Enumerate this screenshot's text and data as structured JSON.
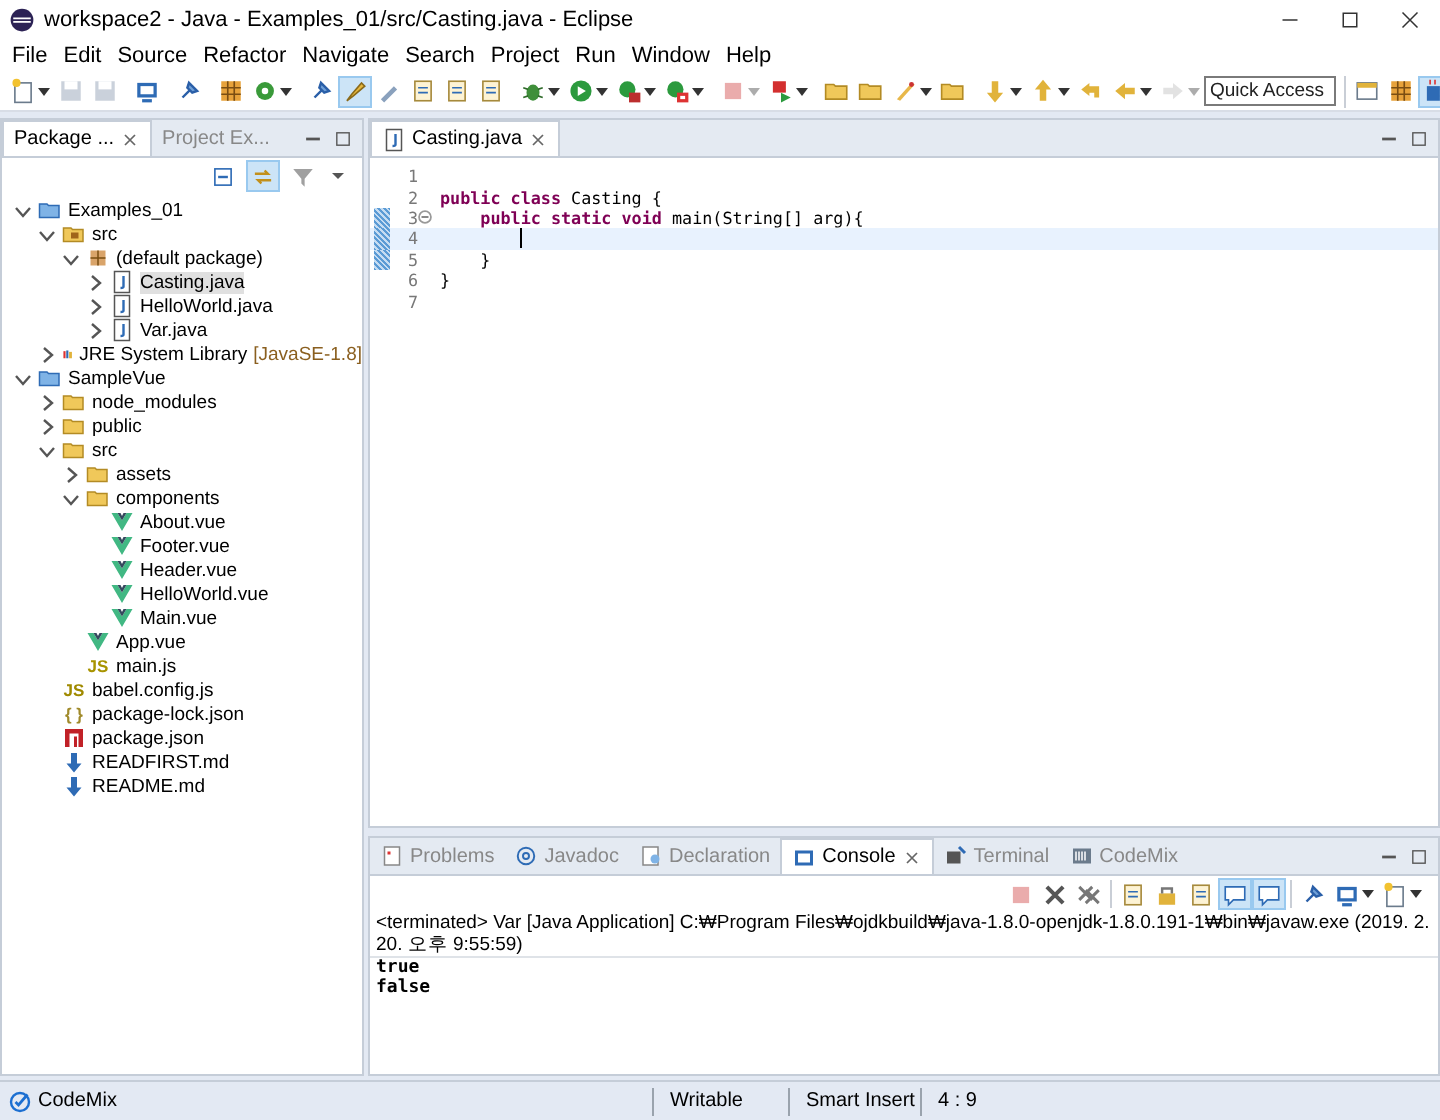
{
  "window": {
    "title": "workspace2 - Java - Examples_01/src/Casting.java - Eclipse"
  },
  "menu": [
    "File",
    "Edit",
    "Source",
    "Refactor",
    "Navigate",
    "Search",
    "Project",
    "Run",
    "Window",
    "Help"
  ],
  "toolbar": [
    {
      "items": [
        {
          "kind": "new",
          "dropdown": true,
          "disabled": false,
          "selected": false
        },
        {
          "kind": "save",
          "dropdown": false,
          "disabled": true,
          "selected": false
        },
        {
          "kind": "save",
          "dropdown": false,
          "disabled": true,
          "selected": false
        }
      ]
    },
    {
      "items": [
        {
          "kind": "monitor",
          "dropdown": false,
          "disabled": false,
          "selected": false
        }
      ]
    },
    {
      "items": [
        {
          "kind": "pin",
          "dropdown": false,
          "disabled": false,
          "selected": false
        }
      ]
    },
    {
      "items": [
        {
          "kind": "grid",
          "dropdown": false,
          "disabled": false,
          "selected": false
        },
        {
          "kind": "gear",
          "dropdown": true,
          "disabled": false,
          "selected": false
        }
      ]
    },
    {
      "items": [
        {
          "kind": "pin",
          "dropdown": false,
          "disabled": false,
          "selected": false
        },
        {
          "kind": "brush",
          "dropdown": false,
          "disabled": false,
          "selected": true
        },
        {
          "kind": "pen",
          "dropdown": false,
          "disabled": false,
          "selected": false
        },
        {
          "kind": "page",
          "dropdown": false,
          "disabled": false,
          "selected": false
        },
        {
          "kind": "page",
          "dropdown": false,
          "disabled": false,
          "selected": false
        },
        {
          "kind": "page",
          "dropdown": false,
          "disabled": false,
          "selected": false
        }
      ]
    },
    {
      "items": [
        {
          "kind": "bug",
          "dropdown": true,
          "disabled": false,
          "selected": false
        },
        {
          "kind": "play",
          "dropdown": true,
          "disabled": false,
          "selected": false
        },
        {
          "kind": "run",
          "dropdown": true,
          "disabled": false,
          "selected": false
        },
        {
          "kind": "coverage",
          "dropdown": true,
          "disabled": false,
          "selected": false
        }
      ]
    },
    {
      "items": [
        {
          "kind": "stop",
          "dropdown": true,
          "disabled": true,
          "selected": false
        },
        {
          "kind": "flag",
          "dropdown": true,
          "disabled": false,
          "selected": false
        }
      ]
    },
    {
      "items": [
        {
          "kind": "folder",
          "dropdown": false,
          "disabled": false,
          "selected": false
        },
        {
          "kind": "folder",
          "dropdown": false,
          "disabled": false,
          "selected": false
        },
        {
          "kind": "rocket",
          "dropdown": true,
          "disabled": false,
          "selected": false
        },
        {
          "kind": "folder",
          "dropdown": false,
          "disabled": false,
          "selected": false
        }
      ]
    },
    {
      "items": [
        {
          "kind": "down",
          "dropdown": true,
          "disabled": false,
          "selected": false
        },
        {
          "kind": "up",
          "dropdown": true,
          "disabled": false,
          "selected": false
        },
        {
          "kind": "back",
          "dropdown": false,
          "disabled": false,
          "selected": false
        },
        {
          "kind": "left",
          "dropdown": true,
          "disabled": false,
          "selected": false
        },
        {
          "kind": "right",
          "dropdown": true,
          "disabled": true,
          "selected": false
        }
      ]
    }
  ],
  "quick_access": {
    "placeholder": "Quick Access"
  },
  "perspectives": [
    {
      "kind": "window",
      "selected": false
    },
    {
      "kind": "grid",
      "selected": false
    },
    {
      "kind": "coffee",
      "selected": true
    }
  ],
  "explorer": {
    "tabs": [
      {
        "label": "Package ...",
        "selected": true
      },
      {
        "label": "Project Ex...",
        "selected": false
      }
    ],
    "tools": [
      {
        "kind": "collapse",
        "selected": false
      },
      {
        "kind": "link",
        "selected": true
      },
      {
        "kind": "filter",
        "selected": false
      }
    ],
    "tree": [
      {
        "label": "Examples_01",
        "kind": "project",
        "leaf": false,
        "expanded": true,
        "selected": false,
        "children": [
          {
            "label": "src",
            "kind": "srcfolder",
            "leaf": false,
            "expanded": true,
            "selected": false,
            "children": [
              {
                "label": "(default package)",
                "kind": "package",
                "leaf": false,
                "expanded": true,
                "selected": false,
                "children": [
                  {
                    "label": "Casting.java",
                    "kind": "java",
                    "leaf": false,
                    "expanded": false,
                    "selected": true
                  },
                  {
                    "label": "HelloWorld.java",
                    "kind": "java",
                    "leaf": false,
                    "expanded": false,
                    "selected": false
                  },
                  {
                    "label": "Var.java",
                    "kind": "java",
                    "leaf": false,
                    "expanded": false,
                    "selected": false
                  }
                ]
              }
            ]
          },
          {
            "label": "JRE System Library",
            "decoration": "[JavaSE-1.8]",
            "kind": "library",
            "leaf": false,
            "expanded": false,
            "selected": false
          }
        ]
      },
      {
        "label": "SampleVue",
        "kind": "project",
        "leaf": false,
        "expanded": true,
        "selected": false,
        "children": [
          {
            "label": "node_modules",
            "kind": "folder",
            "leaf": false,
            "expanded": false,
            "selected": false
          },
          {
            "label": "public",
            "kind": "folder",
            "leaf": false,
            "expanded": false,
            "selected": false
          },
          {
            "label": "src",
            "kind": "folder",
            "leaf": false,
            "expanded": true,
            "selected": false,
            "children": [
              {
                "label": "assets",
                "kind": "folder",
                "leaf": false,
                "expanded": false,
                "selected": false
              },
              {
                "label": "components",
                "kind": "folder",
                "leaf": false,
                "expanded": true,
                "selected": false,
                "children": [
                  {
                    "label": "About.vue",
                    "kind": "vue",
                    "leaf": true,
                    "selected": false
                  },
                  {
                    "label": "Footer.vue",
                    "kind": "vue",
                    "leaf": true,
                    "selected": false
                  },
                  {
                    "label": "Header.vue",
                    "kind": "vue",
                    "leaf": true,
                    "selected": false
                  },
                  {
                    "label": "HelloWorld.vue",
                    "kind": "vue",
                    "leaf": true,
                    "selected": false
                  },
                  {
                    "label": "Main.vue",
                    "kind": "vue",
                    "leaf": true,
                    "selected": false
                  }
                ]
              },
              {
                "label": "App.vue",
                "kind": "vue",
                "leaf": true,
                "selected": false
              },
              {
                "label": "main.js",
                "kind": "js",
                "glyph": "JS",
                "leaf": true,
                "selected": false
              }
            ]
          },
          {
            "label": "babel.config.js",
            "kind": "babel",
            "glyph": "JS",
            "leaf": true,
            "selected": false
          },
          {
            "label": "package-lock.json",
            "kind": "json",
            "glyph": "{ }",
            "leaf": true,
            "selected": false
          },
          {
            "label": "package.json",
            "kind": "npm",
            "leaf": true,
            "selected": false
          },
          {
            "label": "READFIRST.md",
            "kind": "md",
            "leaf": true,
            "selected": false
          },
          {
            "label": "README.md",
            "kind": "md",
            "leaf": true,
            "selected": false
          }
        ]
      }
    ]
  },
  "editor": {
    "tabs": [
      {
        "label": "Casting.java",
        "selected": true
      }
    ],
    "lines": [
      {
        "number": "1",
        "changed": false,
        "fold": false,
        "current": false,
        "cursor": false
      },
      {
        "number": "2",
        "changed": false,
        "fold": false,
        "current": false,
        "cursor": false,
        "segments": [
          {
            "kind": "keyword",
            "text": "public class"
          },
          {
            "kind": "plain",
            "text": " Casting {"
          }
        ]
      },
      {
        "number": "3",
        "changed": true,
        "fold": true,
        "current": false,
        "cursor": false,
        "segments": [
          {
            "kind": "keyword",
            "text": "    public static void"
          },
          {
            "kind": "plain",
            "text": " main(String[] arg){"
          }
        ]
      },
      {
        "number": "4",
        "changed": true,
        "fold": false,
        "current": true,
        "cursor": true
      },
      {
        "number": "5",
        "changed": true,
        "fold": false,
        "current": false,
        "cursor": false,
        "segments": [
          {
            "kind": "plain",
            "text": "    }"
          }
        ]
      },
      {
        "number": "6",
        "changed": false,
        "fold": false,
        "current": false,
        "cursor": false,
        "segments": [
          {
            "kind": "plain",
            "text": "}"
          }
        ]
      },
      {
        "number": "7",
        "changed": false,
        "fold": false,
        "current": false,
        "cursor": false
      }
    ]
  },
  "bottom": {
    "tabs": [
      {
        "label": "Problems",
        "kind": "problems",
        "selected": false
      },
      {
        "label": "Javadoc",
        "kind": "javadoc",
        "selected": false
      },
      {
        "label": "Declaration",
        "kind": "declaration",
        "selected": false
      },
      {
        "label": "Console",
        "kind": "console",
        "selected": true
      },
      {
        "label": "Terminal",
        "kind": "terminal",
        "selected": false
      },
      {
        "label": "CodeMix",
        "kind": "codemix",
        "selected": false
      }
    ],
    "tools": [
      {
        "items": [
          {
            "kind": "stop",
            "dropdown": false,
            "disabled": true,
            "selected": false
          },
          {
            "kind": "remove",
            "dropdown": false,
            "disabled": false,
            "selected": false
          },
          {
            "kind": "removeall",
            "dropdown": false,
            "disabled": false,
            "selected": false
          }
        ]
      },
      {
        "items": [
          {
            "kind": "page",
            "dropdown": false,
            "disabled": false,
            "selected": false
          },
          {
            "kind": "lock",
            "dropdown": false,
            "disabled": false,
            "selected": false
          },
          {
            "kind": "page",
            "dropdown": false,
            "disabled": false,
            "selected": false
          },
          {
            "kind": "comment",
            "dropdown": false,
            "disabled": false,
            "selected": true
          },
          {
            "kind": "comment",
            "dropdown": false,
            "disabled": false,
            "selected": true
          }
        ]
      },
      {
        "items": [
          {
            "kind": "pin",
            "dropdown": false,
            "disabled": false,
            "selected": false
          },
          {
            "kind": "monitor",
            "dropdown": true,
            "disabled": false,
            "selected": false
          },
          {
            "kind": "new",
            "dropdown": true,
            "disabled": false,
            "selected": false
          }
        ]
      }
    ],
    "header": "<terminated> Var [Java Application] C:₩Program Files₩ojdkbuild₩java-1.8.0-openjdk-1.8.0.191-1₩bin₩javaw.exe (2019. 2. 20. 오후 9:55:59)",
    "output": [
      "true",
      "false"
    ]
  },
  "status_bar": {
    "left": "CodeMix",
    "fields": [
      "Writable",
      "Smart Insert",
      "4 : 9"
    ]
  }
}
